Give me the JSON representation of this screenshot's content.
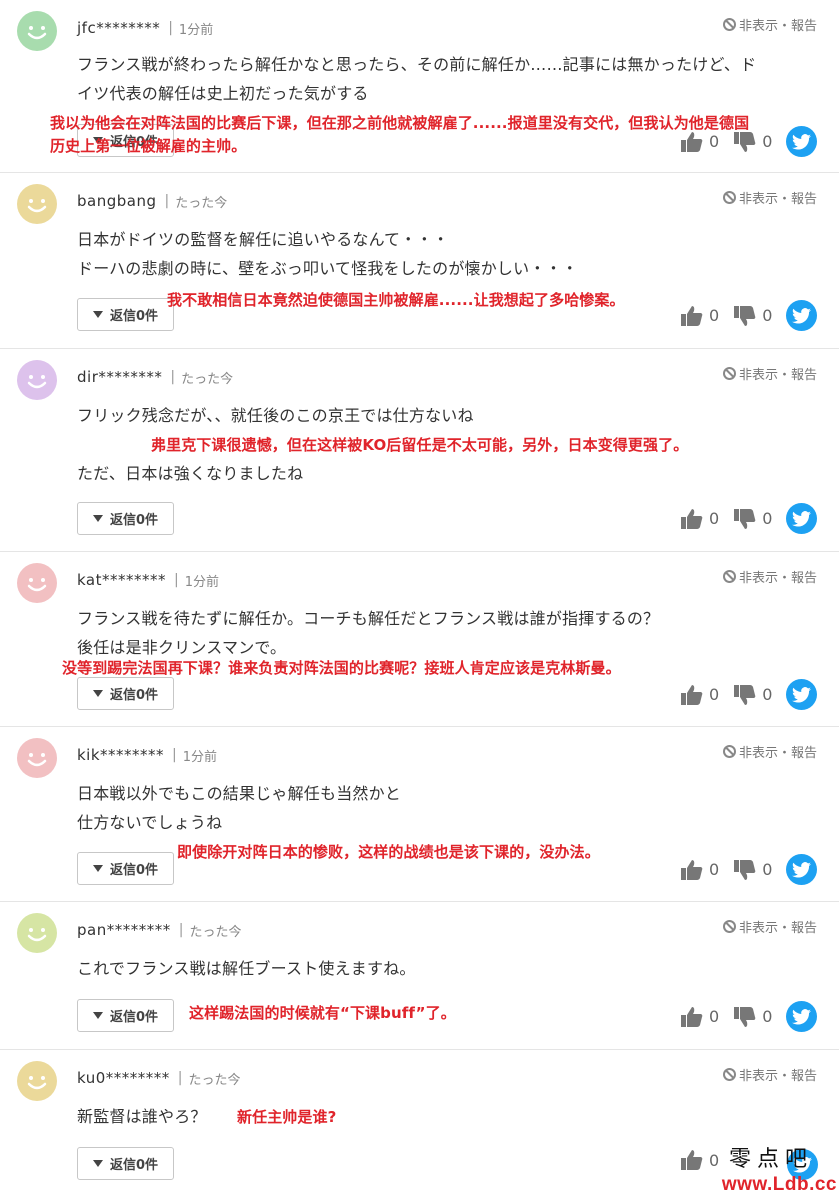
{
  "ui": {
    "hide_label": "非表示・報告",
    "reply_label": "返信0件",
    "like_count": "0",
    "dislike_count": "0"
  },
  "comments": [
    {
      "username": "jfc********",
      "time": "1分前",
      "avatar_color": "#a8dcae",
      "text": "フランス戦が終わったら解任かなと思ったら、その前に解任か……記事には無かったけど、ド\nイツ代表の解任は史上初だった気がする",
      "translation": "我以为他会在对阵法国的比赛后下课，但在那之前他就被解雇了......报道里没有交代，但我认为他是德国\n历史上第一位被解雇的主帅。"
    },
    {
      "username": "bangbang",
      "time": "たった今",
      "avatar_color": "#ebd99a",
      "text": "日本がドイツの監督を解任に追いやるなんて・・・\nドーハの悲劇の時に、壁をぶっ叩いて怪我をしたのが懐かしい・・・",
      "translation": "我不敢相信日本竟然迫使德国主帅被解雇......让我想起了多哈惨案。"
    },
    {
      "username": "dir********",
      "time": "たった今",
      "avatar_color": "#ddc2ec",
      "text": "フリック残念だが、、就任後のこの京王では仕方ないね\n\nただ、日本は強くなりましたね",
      "translation": "弗里克下课很遗憾，但在这样被KO后留任是不太可能，另外，日本变得更强了。"
    },
    {
      "username": "kat********",
      "time": "1分前",
      "avatar_color": "#f2c0c2",
      "text": "フランス戦を待たずに解任か。コーチも解任だとフランス戦は誰が指揮するの？\n後任は是非クリンスマンで。",
      "translation": "没等到踢完法国再下课？谁来负责对阵法国的比赛呢？接班人肯定应该是克林斯曼。"
    },
    {
      "username": "kik********",
      "time": "1分前",
      "avatar_color": "#f2c0c2",
      "text": "日本戦以外でもこの結果じゃ解任も当然かと\n仕方ないでしょうね",
      "translation": "即使除开对阵日本的惨败，这样的战绩也是该下课的，没办法。"
    },
    {
      "username": "pan********",
      "time": "たった今",
      "avatar_color": "#d6e5a4",
      "text": "これでフランス戦は解任ブースト使えますね。",
      "translation": "这样踢法国的时候就有“下课buff”了。"
    },
    {
      "username": "ku0********",
      "time": "たった今",
      "avatar_color": "#ebd99a",
      "text": "新監督は誰やろ？",
      "translation": "新任主帅是谁?"
    }
  ],
  "watermark": {
    "text": "零点吧",
    "url": "www.Ldb.cc"
  }
}
